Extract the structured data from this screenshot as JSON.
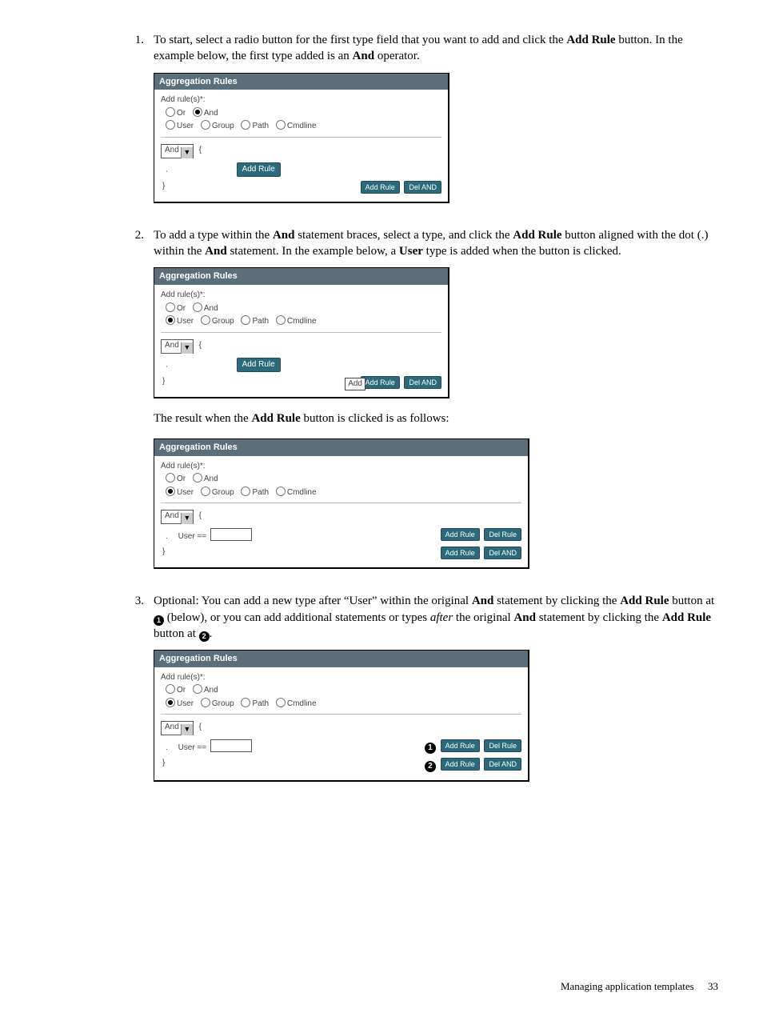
{
  "steps": {
    "s1": {
      "num": "1.",
      "text_before_bold1": "To start, select a radio button for the first type field that you want to add and click the ",
      "bold1": "Add Rule",
      "text_mid1": " button. In the example below, the first type added is an ",
      "bold2": "And",
      "text_after": " operator."
    },
    "s2": {
      "num": "2.",
      "t1": "To add a type within the ",
      "b1": "And",
      "t2": " statement braces, select a type, and click the ",
      "b2": "Add Rule",
      "t3": " button aligned with the dot (.) within the ",
      "b3": "And",
      "t4": "  statement. In the example below, a ",
      "b4": "User",
      "t5": " type is added when the button is clicked."
    },
    "s2_result": {
      "t1": "The result when the ",
      "b1": "Add Rule",
      "t2": " button is clicked is as follows:"
    },
    "s3": {
      "num": "3.",
      "t1": "Optional: You can add a new type after “User” within the original ",
      "b1": "And",
      "t2": " statement by clicking the ",
      "b2": "Add Rule",
      "t3": " button at ",
      "callout1": "1",
      "t4": " (below), or you can add additional statements or types ",
      "i1": "after",
      "t5": " the original ",
      "b3": "And",
      "t6": " statement by clicking the ",
      "b4": "Add Rule",
      "t7": " button at ",
      "callout2": "2",
      "t8": "."
    }
  },
  "panel": {
    "title": "Aggregation Rules",
    "add_label": "Add rule(s)*:",
    "radios_top": {
      "or": "Or",
      "and": "And"
    },
    "radios_type": {
      "user": "User",
      "group": "Group",
      "path": "Path",
      "cmdline": "Cmdline"
    },
    "and_select": "And",
    "open_brace": "{",
    "dot": ".",
    "close_brace": "}",
    "btn_add_rule": "Add Rule",
    "btn_del_and": "Del AND",
    "btn_del_rule": "Del Rule",
    "user_eq": "User ==",
    "tooltip_add": "Add"
  },
  "callouts": {
    "one": "1",
    "two": "2"
  },
  "footer": {
    "section": "Managing application templates",
    "page": "33"
  }
}
